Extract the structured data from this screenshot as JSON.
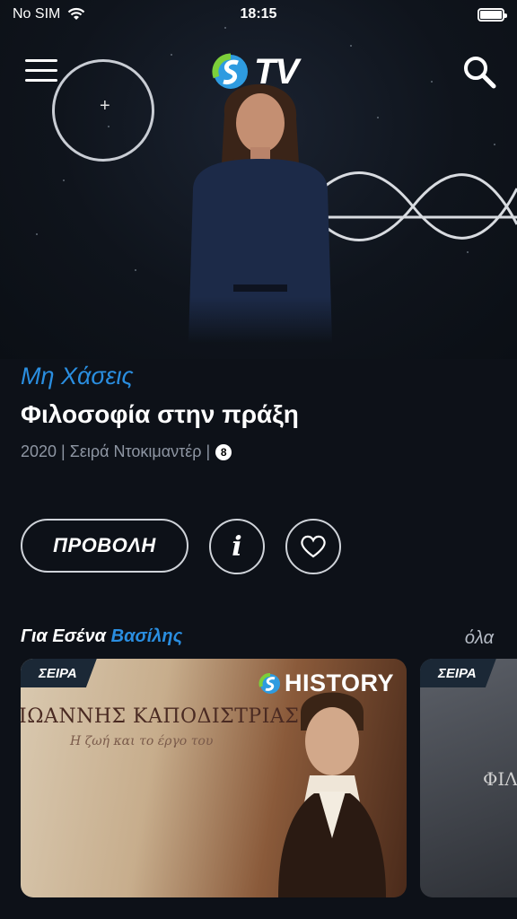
{
  "status_bar": {
    "carrier": "No SIM",
    "time": "18:15"
  },
  "header": {
    "logo_text": "TV"
  },
  "hero": {
    "kicker": "Μη Χάσεις",
    "title": "Φιλοσοφία στην πράξη",
    "meta": "2020 | Σειρά Ντοκιμαντέρ |",
    "rating": "8",
    "play_label": "ΠΡΟΒΟΛΗ",
    "info_label": "i"
  },
  "section": {
    "prefix": "Για Εσένα",
    "user": "Βασίλης",
    "see_all": "όλα"
  },
  "cards": [
    {
      "badge": "ΣΕΙΡΑ",
      "channel": "HISTORY",
      "art_title": "ΙΩΑΝΝΗΣ ΚΑΠΟΔΙΣΤΡΙΑΣ",
      "art_subtitle": "Η ζωή και το έργο του"
    },
    {
      "badge": "ΣΕΙΡΑ",
      "art_title": "ΦΙΛ"
    }
  ],
  "colors": {
    "accent": "#2a8ee0",
    "background": "#0d1118"
  }
}
